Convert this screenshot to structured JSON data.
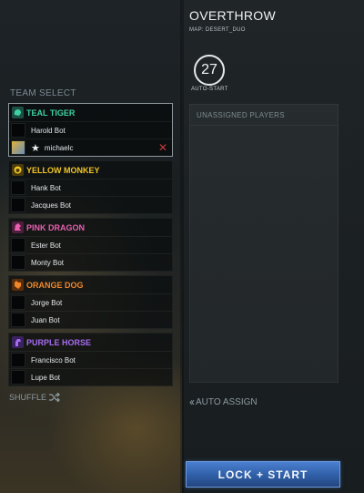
{
  "team_select_label": "TEAM SELECT",
  "teams": [
    {
      "name": "TEAL TIGER",
      "color": "#3fd2a0",
      "icon": "tiger-icon",
      "slots": [
        {
          "name": "Harold Bot"
        },
        {
          "name": "michaelc"
        }
      ]
    },
    {
      "name": "YELLOW MONKEY",
      "color": "#f2c526",
      "icon": "monkey-icon",
      "slots": [
        {
          "name": "Hank Bot"
        },
        {
          "name": "Jacques Bot"
        }
      ]
    },
    {
      "name": "PINK DRAGON",
      "color": "#e85fb0",
      "icon": "dragon-icon",
      "slots": [
        {
          "name": "Ester Bot"
        },
        {
          "name": "Monty Bot"
        }
      ]
    },
    {
      "name": "ORANGE DOG",
      "color": "#f0862a",
      "icon": "dog-icon",
      "slots": [
        {
          "name": "Jorge Bot"
        },
        {
          "name": "Juan Bot"
        }
      ]
    },
    {
      "name": "PURPLE HORSE",
      "color": "#a56cf0",
      "icon": "horse-icon",
      "slots": [
        {
          "name": "Francisco Bot"
        },
        {
          "name": "Lupe Bot"
        }
      ]
    }
  ],
  "shuffle_label": "SHUFFLE",
  "game_mode": "OVERTHROW",
  "map_label": "MAP: DESERT_DUO",
  "countdown": "27",
  "autostart_label": "AUTO-START",
  "unassigned_label": "UNASSIGNED PLAYERS",
  "auto_assign_label": "AUTO ASSIGN",
  "lock_start_label": "LOCK + START",
  "colors": {
    "kick": "#c23a3a",
    "button": "#2f5ea6"
  }
}
